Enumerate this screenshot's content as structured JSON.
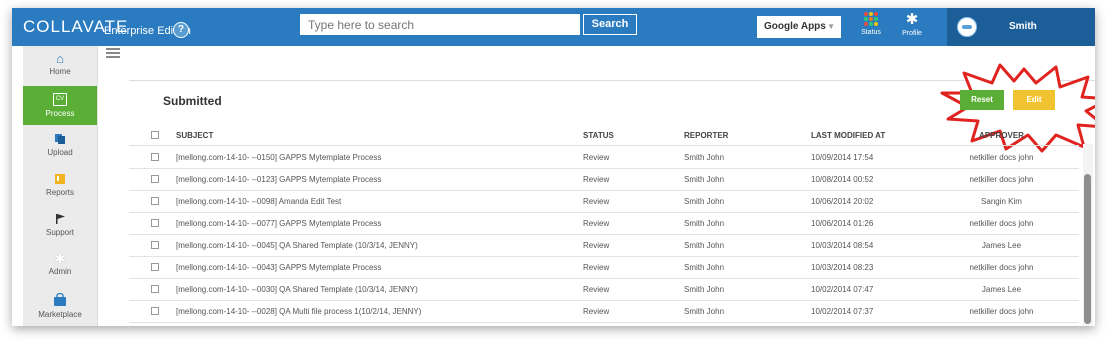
{
  "header": {
    "logo": "COLLAVATE",
    "edition": "Enterprise Edition",
    "help": "?",
    "search_placeholder": "Type here to search",
    "search_button": "Search",
    "apps_selected": "Google Apps",
    "status_label": "Status",
    "profile_label": "Profile",
    "username": "Smith",
    "colors": {
      "bar": "#2a7bbf",
      "user_area": "#1c5f98"
    }
  },
  "sidebar": {
    "items": [
      {
        "label": "Home",
        "icon": "home-icon"
      },
      {
        "label": "Process",
        "icon": "cv-icon",
        "badge": "CV",
        "active": true
      },
      {
        "label": "Upload",
        "icon": "upload-icon"
      },
      {
        "label": "Reports",
        "icon": "reports-icon"
      },
      {
        "label": "Support",
        "icon": "flag-icon"
      },
      {
        "label": "Admin",
        "icon": "gear-icon"
      },
      {
        "label": "Marketplace",
        "icon": "bag-icon"
      }
    ],
    "active_color": "#5aae35"
  },
  "main": {
    "title": "Submitted",
    "reset_label": "Reset",
    "edit_label": "Edit",
    "columns": {
      "subject": "SUBJECT",
      "status": "STATUS",
      "reporter": "REPORTER",
      "modified": "LAST MODIFIED AT",
      "approver": "APPROVER"
    },
    "rows": [
      {
        "subject": "[mellong.com-14-10- --0150] GAPPS Mytemplate Process",
        "status": "Review",
        "reporter": "Smith John",
        "modified": "10/09/2014 17:54",
        "approver": "netkiller docs john"
      },
      {
        "subject": "[mellong.com-14-10- --0123] GAPPS Mytemplate Process",
        "status": "Review",
        "reporter": "Smith John",
        "modified": "10/08/2014 00:52",
        "approver": "netkiller docs john"
      },
      {
        "subject": "[mellong.com-14-10- --0098] Amanda Edit Test",
        "status": "Review",
        "reporter": "Smith John",
        "modified": "10/06/2014 20:02",
        "approver": "Sangin Kim"
      },
      {
        "subject": "[mellong.com-14-10- --0077] GAPPS Mytemplate Process",
        "status": "Review",
        "reporter": "Smith John",
        "modified": "10/06/2014 01:26",
        "approver": "netkiller docs john"
      },
      {
        "subject": "[mellong.com-14-10- --0045] QA Shared Template (10/3/14, JENNY)",
        "status": "Review",
        "reporter": "Smith John",
        "modified": "10/03/2014 08:54",
        "approver": "James Lee"
      },
      {
        "subject": "[mellong.com-14-10- --0043] GAPPS Mytemplate Process",
        "status": "Review",
        "reporter": "Smith John",
        "modified": "10/03/2014 08:23",
        "approver": "netkiller docs john"
      },
      {
        "subject": "[mellong.com-14-10- --0030] QA Shared Template (10/3/14, JENNY)",
        "status": "Review",
        "reporter": "Smith John",
        "modified": "10/02/2014 07:47",
        "approver": "James Lee"
      },
      {
        "subject": "[mellong.com-14-10- --0028] QA Multi file process 1(10/2/14, JENNY)",
        "status": "Review",
        "reporter": "Smith John",
        "modified": "10/02/2014 07:37",
        "approver": "netkiller docs john"
      }
    ],
    "button_colors": {
      "reset": "#5aae35",
      "edit": "#f2c331"
    },
    "callout_color": "#e0231f"
  }
}
